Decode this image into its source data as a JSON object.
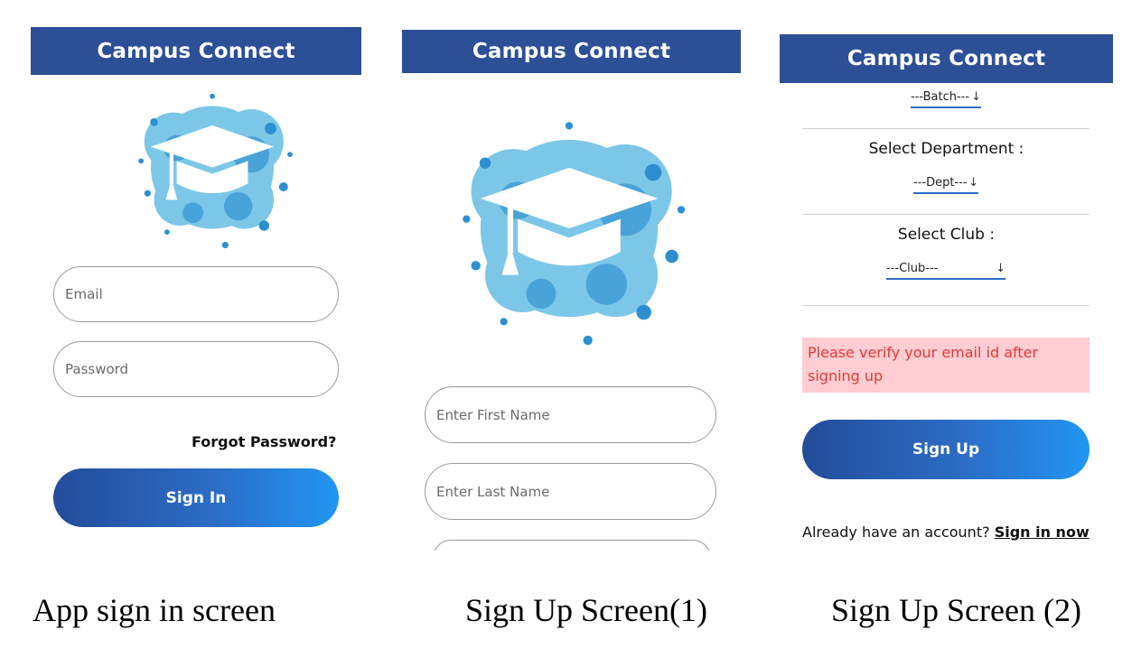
{
  "app": {
    "title": "Campus Connect"
  },
  "signin": {
    "email_placeholder": "Email",
    "password_placeholder": "Password",
    "forgot_label": "Forgot Password?",
    "signin_label": "Sign In"
  },
  "signup1": {
    "first_name_placeholder": "Enter First Name",
    "last_name_placeholder": "Enter Last Name"
  },
  "signup2": {
    "batch_value": "---Batch---",
    "department_label": "Select Department :",
    "dept_value": "---Dept---",
    "club_label": "Select Club :",
    "club_value": "---Club---",
    "alert_text": "Please verify your email id after signing up",
    "signup_label": "Sign Up",
    "account_prompt": "Already have an account?",
    "signin_link": "Sign in now"
  },
  "captions": {
    "signin": "App sign in screen",
    "signup1": "Sign Up Screen(1)",
    "signup2": "Sign Up Screen (2)"
  },
  "colors": {
    "appbar": "#2d4f96",
    "gradient_start": "#244c9a",
    "gradient_end": "#2196f3",
    "alert_bg": "#ffcdd2",
    "alert_text": "#e53935"
  },
  "icons": {
    "logo": "graduation-cap-splash-icon",
    "dropdown_arrow": "arrow-down-icon"
  }
}
